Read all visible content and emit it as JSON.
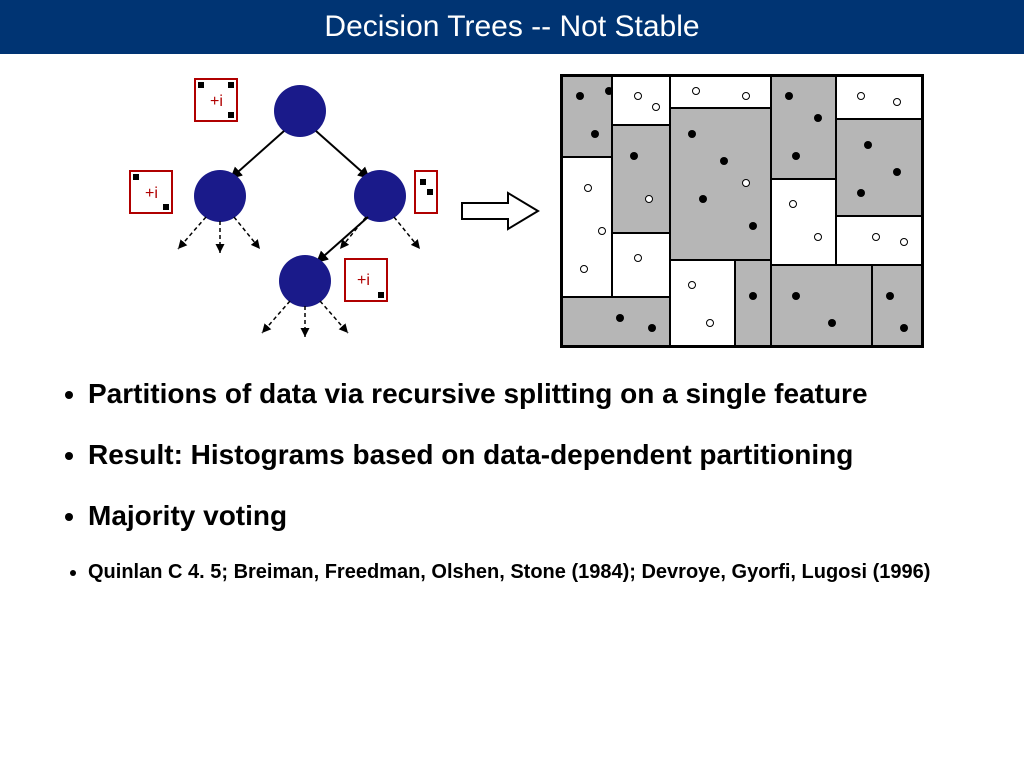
{
  "title": "Decision Trees -- Not Stable",
  "bullets": {
    "b1": "Partitions of data via recursive splitting on a single feature",
    "b2": "Result: Histograms based on data-dependent partitioning",
    "b3": "Majority voting",
    "b4": "Quinlan C 4. 5; Breiman, Freedman, Olshen, Stone (1984); Devroye, Gyorfi, Lugosi (1996)"
  },
  "figure": {
    "tree_label_plus_i": "+i",
    "icons": {
      "arrow": "arrow-right-icon",
      "tree_node": "tree-node-icon",
      "partition": "partition-diagram-icon"
    }
  }
}
